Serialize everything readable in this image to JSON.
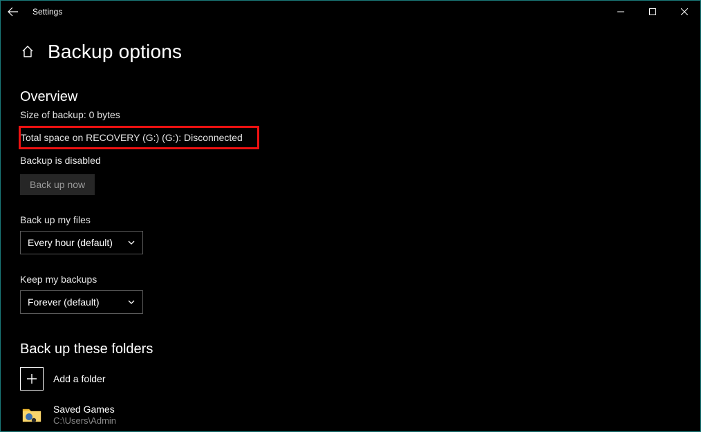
{
  "titlebar": {
    "app_name": "Settings"
  },
  "header": {
    "page_title": "Backup options"
  },
  "overview": {
    "heading": "Overview",
    "size_line": "Size of backup: 0 bytes",
    "space_line": "Total space on RECOVERY (G:) (G:): Disconnected",
    "status_line": "Backup is disabled",
    "backup_now_label": "Back up now"
  },
  "frequency": {
    "label": "Back up my files",
    "selected": "Every hour (default)"
  },
  "retention": {
    "label": "Keep my backups",
    "selected": "Forever (default)"
  },
  "folders": {
    "heading": "Back up these folders",
    "add_label": "Add a folder",
    "items": [
      {
        "name": "Saved Games",
        "path": "C:\\Users\\Admin"
      }
    ]
  }
}
